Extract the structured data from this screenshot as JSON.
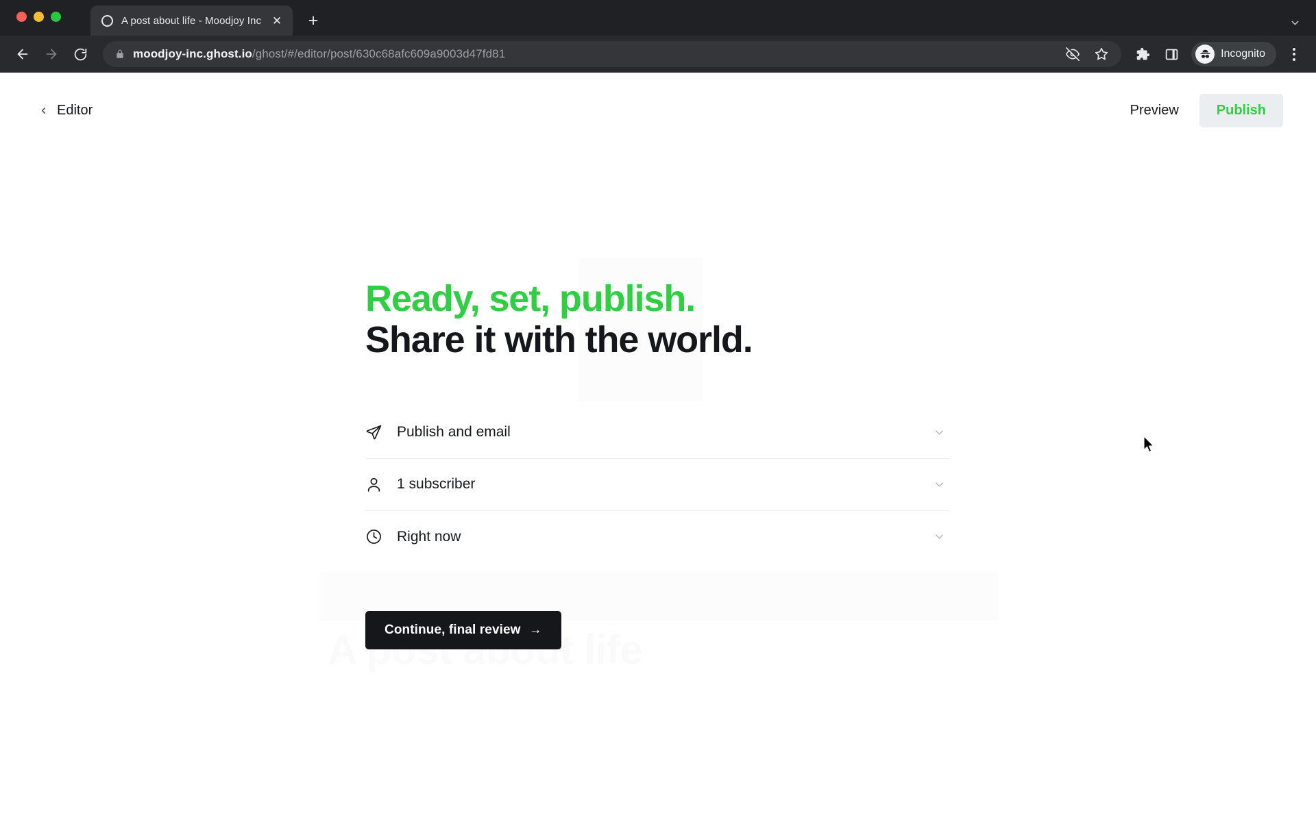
{
  "browser": {
    "window_controls": [
      "close",
      "minimize",
      "maximize"
    ],
    "tab": {
      "title": "A post about life - Moodjoy Inc",
      "favicon": "ghost-logo-icon",
      "close_label": "✕"
    },
    "new_tab_label": "+",
    "tab_list_chevron": "⌄",
    "toolbar": {
      "back_label": "back-arrow",
      "forward_label": "forward-arrow",
      "reload_label": "reload",
      "url_host": "moodjoy-inc.ghost.io",
      "url_path": "/ghost/#/editor/post/630c68afc609a9003d47fd81",
      "lock_icon": "lock-icon",
      "tracking_protection_icon": "eye-slash-icon",
      "bookmark_icon": "star-icon",
      "extensions_icon": "puzzle-icon",
      "side_panel_icon": "side-panel-icon",
      "profile_label": "Incognito",
      "menu_icon": "three-dot-menu-icon"
    }
  },
  "header": {
    "back_label": "Editor",
    "preview_label": "Preview",
    "publish_label": "Publish"
  },
  "publish_flow": {
    "headline_line1": "Ready, set, publish.",
    "headline_line2": "Share it with the world.",
    "options": [
      {
        "icon": "paper-plane-icon",
        "label": "Publish and email",
        "chevron": "chevron-down-icon"
      },
      {
        "icon": "person-icon",
        "label": "1 subscriber",
        "chevron": "chevron-down-icon"
      },
      {
        "icon": "clock-icon",
        "label": "Right now",
        "chevron": "chevron-down-icon"
      }
    ],
    "continue_label": "Continue, final review",
    "continue_arrow": "→"
  },
  "background": {
    "post_title": "A post about life"
  },
  "colors": {
    "accent_green": "#30cf43",
    "text_dark": "#15171a",
    "chrome_dark": "#202124",
    "toolbar_dark": "#292a2d",
    "tab_active": "#35363a",
    "button_dark": "#15171a",
    "publish_bg": "#ebeef0"
  }
}
